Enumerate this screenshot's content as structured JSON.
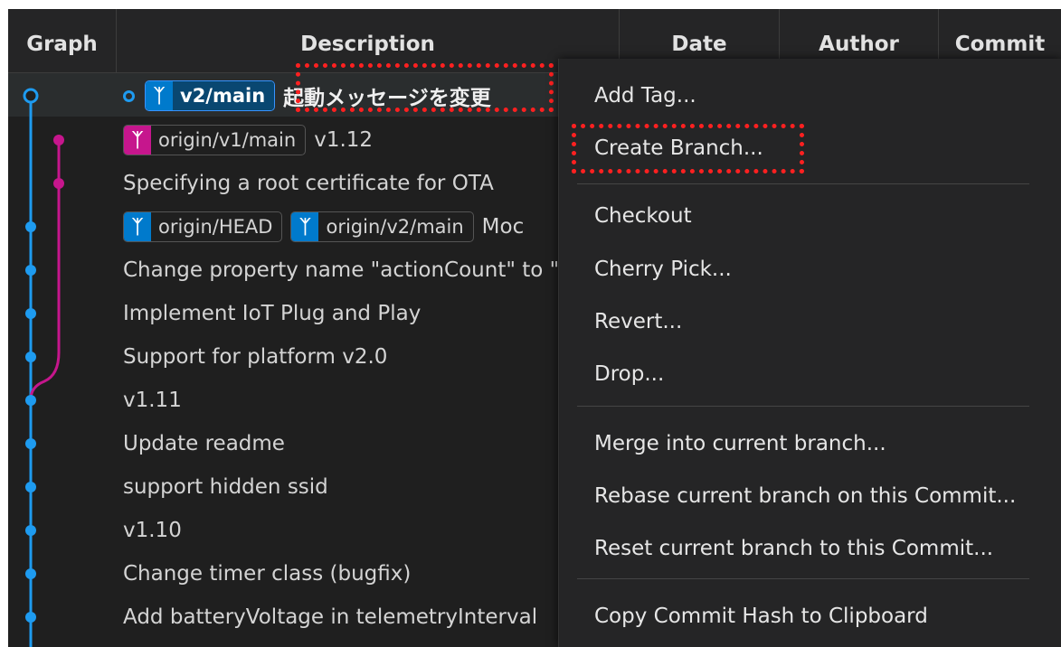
{
  "header": {
    "graph": "Graph",
    "description": "Description",
    "date": "Date",
    "author": "Author",
    "commit": "Commit"
  },
  "commits": [
    {
      "refs": [
        "v2/main"
      ],
      "message": "起動メッセージを変更"
    },
    {
      "refs": [
        "origin/v1/main"
      ],
      "message": "v1.12"
    },
    {
      "refs": [],
      "message": "Specifying a root certificate for OTA"
    },
    {
      "refs": [
        "origin/HEAD",
        "origin/v2/main"
      ],
      "message": "Moc"
    },
    {
      "refs": [],
      "message": "Change property name \"actionCount\" to \""
    },
    {
      "refs": [],
      "message": "Implement IoT Plug and Play"
    },
    {
      "refs": [],
      "message": "Support for platform v2.0"
    },
    {
      "refs": [],
      "message": "v1.11"
    },
    {
      "refs": [],
      "message": "Update readme"
    },
    {
      "refs": [],
      "message": "support hidden ssid"
    },
    {
      "refs": [],
      "message": "v1.10"
    },
    {
      "refs": [],
      "message": "Change timer class (bugfix)"
    },
    {
      "refs": [],
      "message": "Add batteryVoltage in telemetryInterval"
    }
  ],
  "context_menu": {
    "add_tag": "Add Tag...",
    "create_branch": "Create Branch...",
    "checkout": "Checkout",
    "cherry_pick": "Cherry Pick...",
    "revert": "Revert...",
    "drop": "Drop...",
    "merge": "Merge into current branch...",
    "rebase": "Rebase current branch on this Commit...",
    "reset": "Reset current branch to this Commit...",
    "copy_hash": "Copy Commit Hash to Clipboard"
  },
  "colors": {
    "main_branch": "#1e9bf0",
    "v1_branch": "#c6168d",
    "highlight": "#ff2020"
  },
  "icons": {
    "branch": "branch-icon",
    "head_marker": "hollow-circle-icon"
  }
}
